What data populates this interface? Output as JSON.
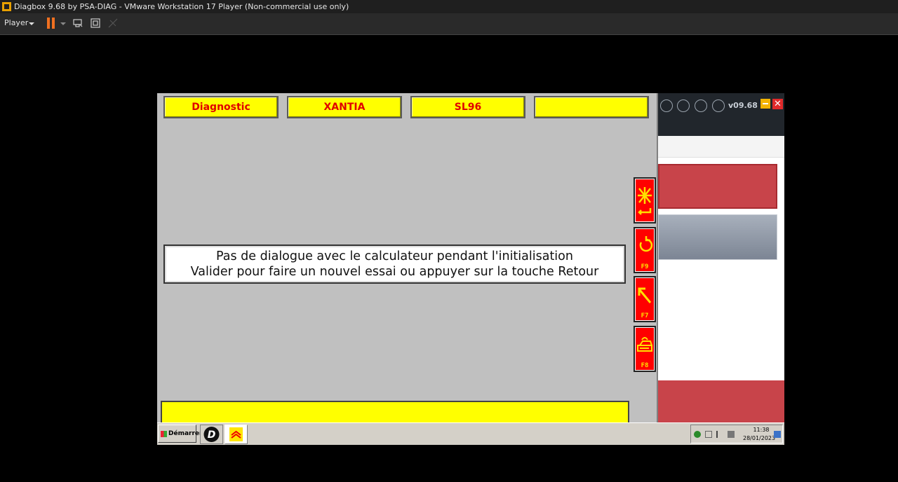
{
  "vmware": {
    "title": "Diagbox 9.68 by PSA-DIAG - VMware Workstation 17 Player (Non-commercial use only)",
    "toolbar": {
      "player_label": "Player"
    }
  },
  "diagbox_panel": {
    "version": "v09.68",
    "close_glyph": "✕"
  },
  "diagnostic": {
    "tabs": [
      {
        "label": "Diagnostic"
      },
      {
        "label": "XANTIA"
      },
      {
        "label": "SL96"
      },
      {
        "label": ""
      }
    ],
    "message_lines": [
      "Pas de dialogue avec le calculateur pendant l'initialisation",
      "Valider pour faire un nouvel essai ou appuyer sur la touche Retour"
    ],
    "function_keys": [
      {
        "label": "",
        "icon": "validate-enter-icon"
      },
      {
        "label": "F9",
        "icon": "retry-arrow-icon"
      },
      {
        "label": "F7",
        "icon": "back-arrow-icon"
      },
      {
        "label": "F8",
        "icon": "print-icon"
      }
    ],
    "colors": {
      "tab_bg": "#ffff00",
      "tab_text": "#e00000",
      "fkey_bg": "#ff0000",
      "fkey_glyph": "#ffe000"
    }
  },
  "taskbar": {
    "start_label": "Démarrer",
    "clock_time": "11:38",
    "clock_date": "28/01/2023"
  }
}
